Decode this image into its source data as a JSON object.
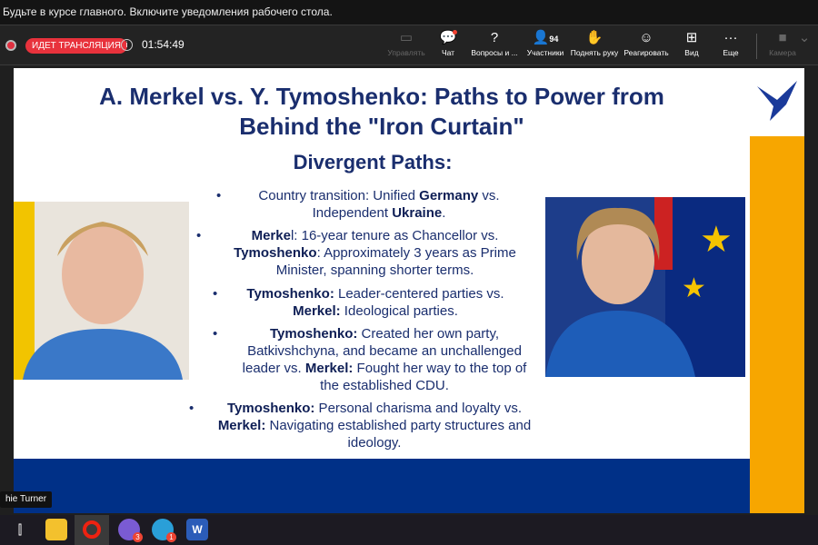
{
  "notification": "Будьте в курсе главного. Включите уведомления рабочего стола.",
  "meeting": {
    "live_label": "ИДЕТ ТРАНСЛЯЦИЯ",
    "timer": "01:54:49",
    "tools": [
      {
        "label": "Управлять",
        "icon": "share-screen-icon"
      },
      {
        "label": "Чат",
        "icon": "chat-icon"
      },
      {
        "label": "Вопросы и ...",
        "icon": "qa-icon"
      },
      {
        "label": "Участники",
        "icon": "participants-icon",
        "count": "94"
      },
      {
        "label": "Поднять руку",
        "icon": "raise-hand-icon"
      },
      {
        "label": "Реагировать",
        "icon": "react-icon"
      },
      {
        "label": "Вид",
        "icon": "view-icon"
      },
      {
        "label": "Еще",
        "icon": "more-icon"
      },
      {
        "label": "Камера",
        "icon": "camera-icon"
      }
    ]
  },
  "slide": {
    "title": "A. Merkel vs. Y. Tymoshenko: Paths to Power from Behind the \"Iron Curtain\"",
    "subtitle": "Divergent Paths:",
    "bullets": [
      [
        "Country transition: Unified ",
        "Germany",
        " vs. Independent ",
        "Ukraine",
        "."
      ],
      [
        "",
        "Merke",
        "l: 16-year tenure as Chancellor vs. ",
        "Tymoshenko",
        ": Approximately 3 years as Prime Minister, spanning shorter terms."
      ],
      [
        "",
        "Tymoshenko:",
        " Leader-centered parties vs. ",
        "Merkel:",
        " Ideological parties."
      ],
      [
        "",
        "Tymoshenko:",
        " Created her own party, Batkivshchyna, and became an unchallenged leader vs. ",
        "Merkel:",
        " Fought her way to the top of the established CDU."
      ],
      [
        "",
        "Tymoshenko:",
        " Personal charisma and loyalty vs. ",
        "Merkel:",
        " Navigating established party structures and ideology."
      ]
    ]
  },
  "speaker_name": "hie Turner",
  "taskbar": {
    "viber_badge": "3",
    "telegram_badge": "1"
  },
  "colors": {
    "slide_blue": "#003087",
    "slide_orange": "#f7a600",
    "title": "#1a2e6e",
    "live": "#e8323c"
  }
}
